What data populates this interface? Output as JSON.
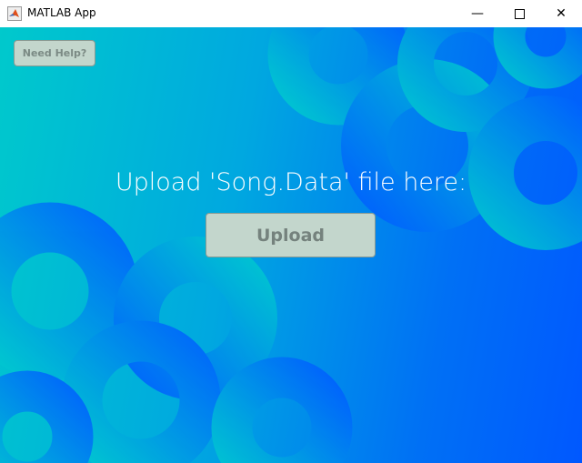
{
  "window": {
    "title": "MATLAB App",
    "minimize_icon": "minimize-icon",
    "maximize_icon": "maximize-icon",
    "close_icon": "close-icon"
  },
  "main": {
    "help_button": "Need Help?",
    "heading": "Upload 'Song.Data' file here:",
    "upload_button": "Upload"
  },
  "colors": {
    "bg_left": "#00c9cc",
    "bg_right": "#0058ff",
    "button": "#c3d6cc"
  }
}
